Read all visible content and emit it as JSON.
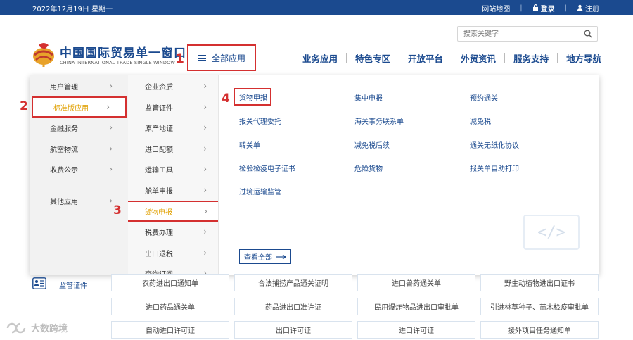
{
  "topbar": {
    "date": "2022年12月19日 星期一",
    "sitemap": "网站地图",
    "login": "登录",
    "register": "注册"
  },
  "search": {
    "placeholder": "搜索关键字"
  },
  "brand": {
    "cn": "中国国际贸易单一窗口",
    "en": "CHINA INTERNATIONAL TRADE SINGLE WINDOW"
  },
  "all_apps": "全部应用",
  "nav": [
    "业务应用",
    "特色专区",
    "开放平台",
    "外贸资讯",
    "服务支持",
    "地方导航"
  ],
  "annotations": [
    "1",
    "2",
    "3",
    "4"
  ],
  "menu": {
    "col1": [
      {
        "label": "用户管理"
      },
      {
        "label": "标准版应用",
        "active": true
      },
      {
        "label": "金融服务"
      },
      {
        "label": "航空物流"
      },
      {
        "label": "收费公示"
      },
      {
        "label": "其他应用"
      }
    ],
    "col2": [
      {
        "label": "企业资质"
      },
      {
        "label": "监管证件"
      },
      {
        "label": "原产地证"
      },
      {
        "label": "进口配额"
      },
      {
        "label": "运输工具"
      },
      {
        "label": "舱单申报"
      },
      {
        "label": "货物申报",
        "active": true
      },
      {
        "label": "税费办理"
      },
      {
        "label": "出口退税"
      },
      {
        "label": "查询订阅"
      }
    ],
    "links": [
      [
        "货物申报",
        "集中申报",
        "预约通关"
      ],
      [
        "报关代理委托",
        "海关事务联系单",
        "减免税"
      ],
      [
        "转关单",
        "减免税后续",
        "通关无纸化协议"
      ],
      [
        "检验检疫电子证书",
        "危险货物",
        "报关单自助打印"
      ],
      [
        "过境运输监管"
      ]
    ],
    "view_all": "查看全部",
    "code_glyph": "</>"
  },
  "service": {
    "label": "监管证件",
    "grid": [
      [
        "农药进出口通知单",
        "合法捕捞产品通关证明",
        "进口兽药通关单",
        "野生动植物进出口证书"
      ],
      [
        "进口药品通关单",
        "药品进出口准许证",
        "民用爆炸物品进出口审批单",
        "引进林草种子、苗木检疫审批单"
      ],
      [
        "自动进口许可证",
        "出口许可证",
        "进口许可证",
        "援外项目任务通知单"
      ]
    ]
  },
  "watermark": "大数跨境",
  "colors": {
    "primary": "#1b4a8f",
    "annotation": "#d43030",
    "active_text": "#e0a000"
  }
}
